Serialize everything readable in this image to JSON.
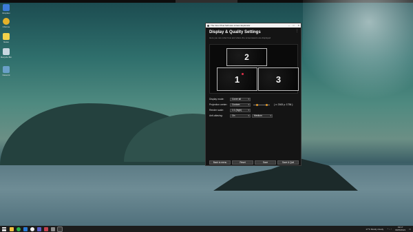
{
  "desktop": {
    "icons": [
      {
        "label": "Dropbox",
        "color": "#3d7bd9"
      },
      {
        "label": "Chrome",
        "color": "#e4b12a"
      },
      {
        "label": "Notes",
        "color": "#f2d24a"
      },
      {
        "label": "Recycle Bin",
        "color": "#c9d6e0"
      },
      {
        "label": "Network",
        "color": "#6aa0c8"
      }
    ]
  },
  "window": {
    "title": "The Inner Pixel Self-care screen Explorator",
    "heading": "Display & Quality Settings",
    "subtitle": "Here you can order how and where the screensavers are displayed",
    "monitors": [
      {
        "number": "2"
      },
      {
        "number": "1"
      },
      {
        "number": "3"
      }
    ],
    "settings": {
      "display_mode": {
        "label": "Display mode:",
        "value": "Cover all"
      },
      "projection_center": {
        "label": "Projection center:",
        "value": "Custom",
        "coords": "( x: 2163 y: 1736 )"
      },
      "render_scale": {
        "label": "Render scale:",
        "value": "1:1 (high)"
      },
      "anti_aliasing": {
        "label": "Anti-aliasing:",
        "value": "On",
        "quality": "Medium"
      }
    },
    "buttons": {
      "back": "Back to menu",
      "reset": "Reset",
      "save": "Save",
      "save_quit": "Save & Quit"
    },
    "accent": "#e39a2c"
  },
  "taskbar": {
    "weather": "17°C  Mostly cloudy",
    "time": "19:17",
    "date": "09/06/2021"
  }
}
